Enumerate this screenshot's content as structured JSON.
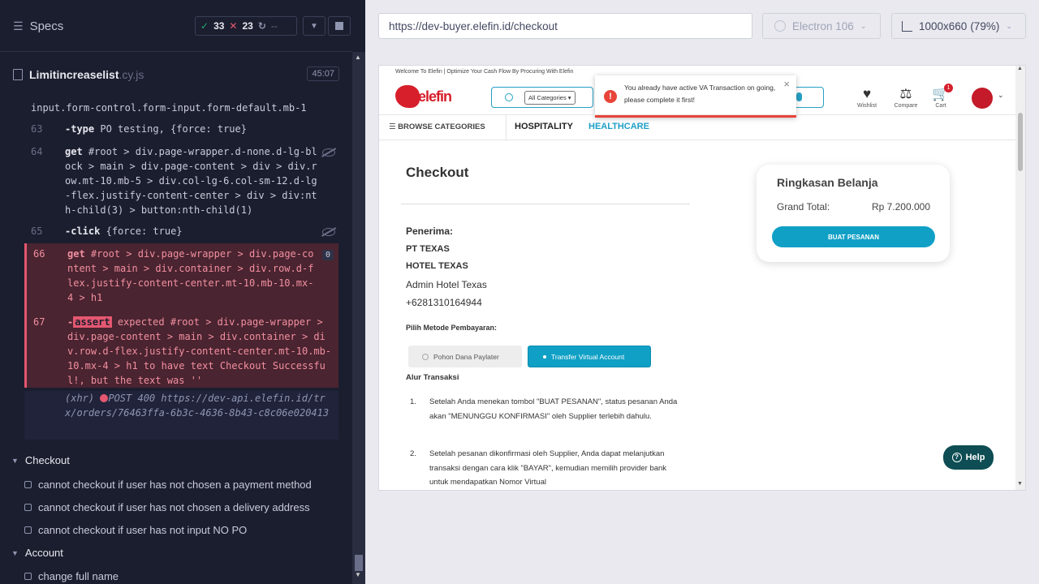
{
  "runner": {
    "specs_label": "Specs",
    "passed": "33",
    "failed": "23",
    "pending": "--",
    "file_name": "Limitincreaselist",
    "file_ext": ".cy.js",
    "duration": "45:07",
    "commands": [
      {
        "num": "",
        "kw": "",
        "text": "input.form-control.form-input.form-default.mb-1"
      },
      {
        "num": "63",
        "kw": "-type",
        "text": "PO testing, {force: true}"
      },
      {
        "num": "64",
        "kw": "get",
        "text": "#root > div.page-wrapper.d-none.d-lg-block > main > div.page-content > div > div.row.mt-10.mb-5 > div.col-lg-6.col-sm-12.d-lg-flex.justify-content-center > div > div:nth-child(3) > button:nth-child(1)"
      },
      {
        "num": "65",
        "kw": "-click",
        "text": "{force: true}"
      },
      {
        "num": "66",
        "kw": "get",
        "text": "#root > div.page-wrapper > div.page-content > main > div.container > div.row.d-flex.justify-content-center.mt-10.mb-10.mx-4 > h1",
        "badge": "0"
      },
      {
        "num": "67",
        "kw": "-",
        "assert": "assert",
        "text": "expected #root > div.page-wrapper > div.page-content > main > div.container > div.row.d-flex.justify-content-center.mt-10.mb-10.mx-4 > h1 to have text Checkout Successful!, but the text was ''"
      },
      {
        "num": "",
        "kw": "(xhr)",
        "text": "POST 400 https://dev-api.elefin.id/trx/orders/76463ffa-6b3c-4636-8b43-c8c06e020413"
      }
    ],
    "suites": [
      {
        "name": "Checkout",
        "tests": [
          "cannot checkout if user has not chosen a payment method",
          "cannot checkout if user has not chosen a delivery address",
          "cannot checkout if user has not input NO PO"
        ]
      },
      {
        "name": "Account",
        "tests": [
          "change full name"
        ]
      }
    ]
  },
  "browser": {
    "url": "https://dev-buyer.elefin.id/checkout",
    "engine": "Electron 106",
    "viewport": "1000x660",
    "zoom": "(79%)"
  },
  "app": {
    "welcome": "Welcome To Elefin | Optimize Your Cash Flow By Procuring With Elefin",
    "logo_text": "elefin",
    "category_select": "All Categories",
    "toast": "You already have active VA Transaction on going, please complete it first!",
    "nav_icons": [
      "Wishlist",
      "Compare",
      "Cart"
    ],
    "cart_count": "1",
    "browse_categories": "BROWSE CATEGORIES",
    "menu_hospitality": "HOSPITALITY",
    "menu_healthcare": "HEALTHCARE",
    "checkout_title": "Checkout",
    "recipient_label": "Penerima:",
    "recipient_company": "PT TEXAS",
    "recipient_hotel": "HOTEL TEXAS",
    "recipient_name": "Admin Hotel Texas",
    "recipient_phone": "+6281310164944",
    "payment_label": "Pilih Metode Pembayaran:",
    "payment_option_1": "Pohon Dana Paylater",
    "payment_option_2": "Transfer Virtual Account",
    "flow_label": "Alur Transaksi",
    "steps": [
      {
        "n": "1.",
        "text": "Setelah Anda menekan tombol \"BUAT PESANAN\", status pesanan Anda akan \"MENUNGGU KONFIRMASI\" oleh Supplier terlebih dahulu."
      },
      {
        "n": "2.",
        "text": "Setelah pesanan dikonfirmasi oleh Supplier, Anda dapat melanjutkan transaksi dengan cara klik \"BAYAR\", kemudian memilih provider bank untuk mendapatkan Nomor Virtual"
      }
    ],
    "summary_title": "Ringkasan Belanja",
    "grand_total_label": "Grand Total:",
    "grand_total_value": "Rp 7.200.000",
    "order_button": "BUAT PESANAN",
    "help_label": "Help"
  },
  "colors": {
    "pass": "#1fa971",
    "fail": "#e45770",
    "accent": "#10a0c6",
    "brand": "#d61f2b"
  }
}
